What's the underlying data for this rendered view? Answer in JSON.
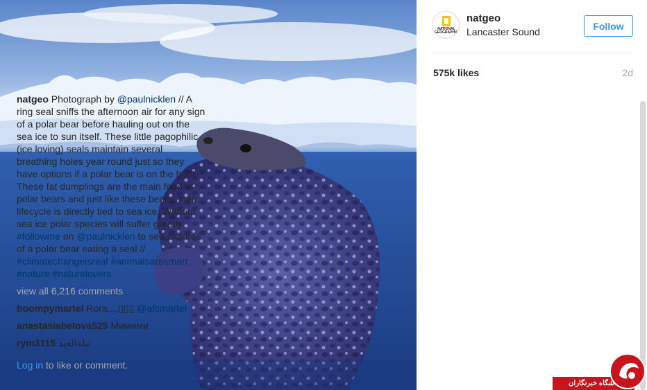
{
  "photo": {
    "icon": "seal-under-ice-photo"
  },
  "header": {
    "avatar_text": "NATIONAL GEOGRAPHIC",
    "username": "natgeo",
    "location": "Lancaster Sound",
    "follow_label": "Follow"
  },
  "stats": {
    "likes": "575k likes",
    "time_ago": "2d"
  },
  "caption": {
    "user": "natgeo",
    "text1": "Photograph by ",
    "mention1": "@paulnicklen",
    "text2": " // A ring seal sniffs the afternoon air for any sign of a polar bear before hauling out on the sea ice to sun itself. These little pagophilic (ice loving) seals maintain several breathing holes year round just so they have options if a polar bear is on the hunt. These fat dumplings are the main food of polar bears and just like these bears, their lifecycle is directly tied to sea ice. Without sea ice polar species will suffer greatly. ",
    "hashtag1": "#followme",
    "text3": " on ",
    "mention2": "@paulnicklen",
    "text4": " to see pictures of a polar bear eating a seal // ",
    "hashtag2": "#climatechangeisreal",
    "hashtag3": "#animalsaresmart",
    "hashtag4": "#nature",
    "hashtag5": "#naturelovers"
  },
  "view_all": "view all 6,216 comments",
  "comments": [
    {
      "user": "boompymartel",
      "text": "Rora....▯▯▯ ",
      "mention": "@afcmartel"
    },
    {
      "user": "anastasiabelova525",
      "text": "Мимими"
    },
    {
      "user": "rym3115",
      "text": "تبلةالعيد"
    }
  ],
  "login_prompt": {
    "link": "Log in",
    "text": " to like or comment."
  },
  "watermark": {
    "text": "باشگاه خبرنگاران"
  },
  "colors": {
    "accent": "#3897f0",
    "link": "#003569",
    "muted": "#a5a7aa",
    "watermark_red": "#c8141d"
  }
}
